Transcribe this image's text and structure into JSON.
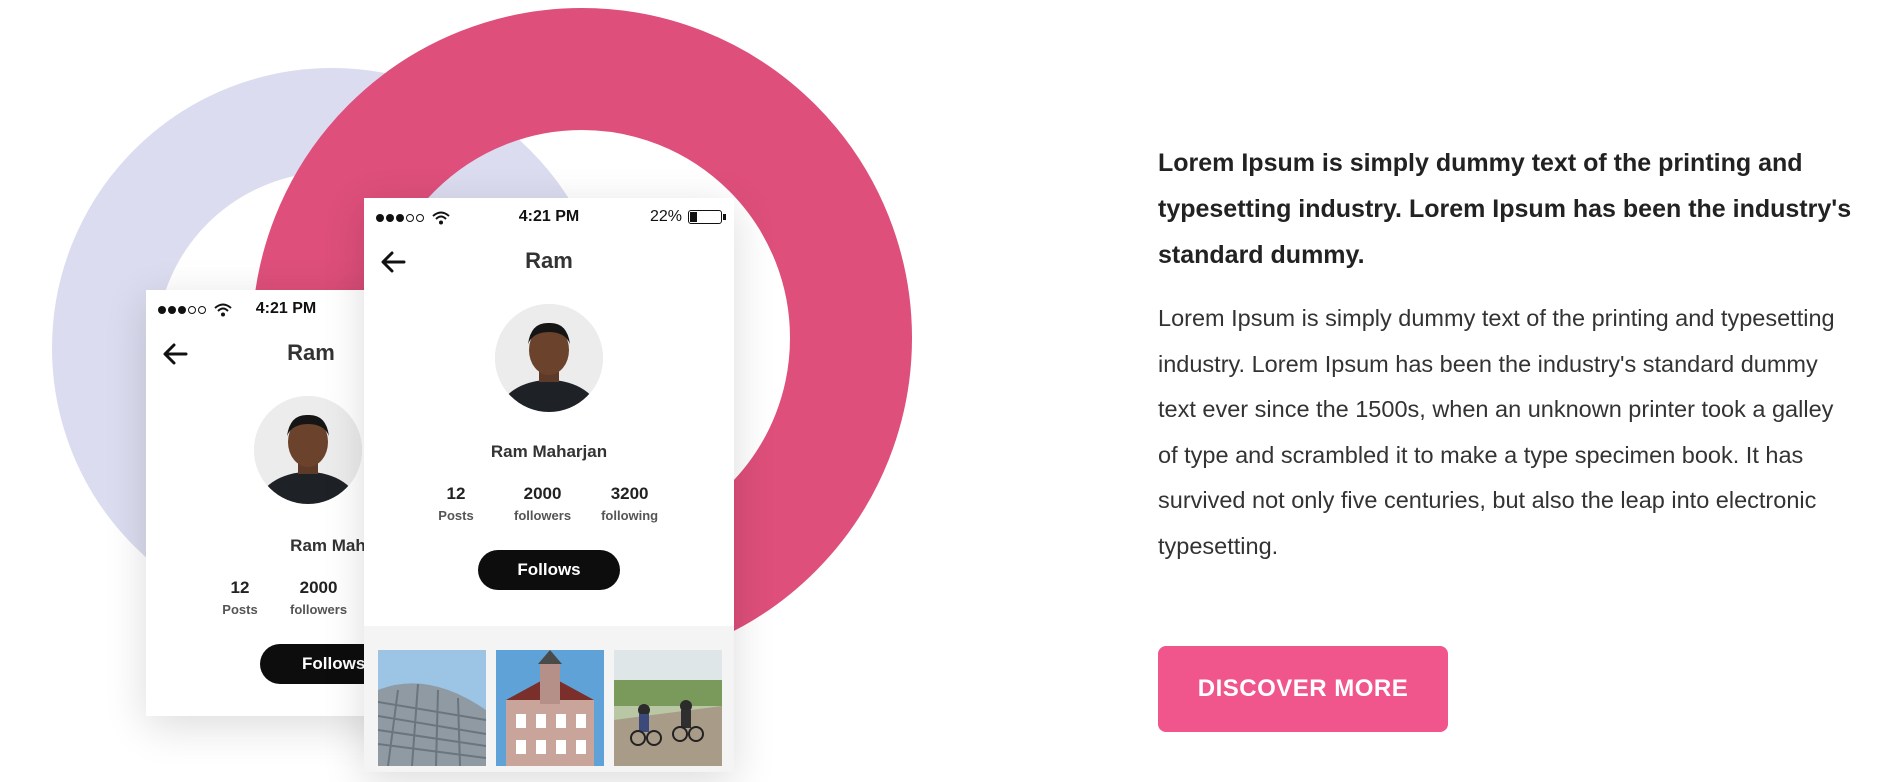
{
  "colors": {
    "ring_lavender": "#dcdcf0",
    "ring_pink": "#de4f7b",
    "button_pink": "#f0568b",
    "follow_button": "#0d0d0d"
  },
  "phone_front": {
    "time": "4:21 PM",
    "battery_text": "22%",
    "battery_level": 0.22,
    "title": "Ram",
    "full_name": "Ram Maharjan",
    "stats": [
      {
        "value": "12",
        "label": "Posts"
      },
      {
        "value": "2000",
        "label": "followers"
      },
      {
        "value": "3200",
        "label": "following"
      }
    ],
    "follow_label": "Follows"
  },
  "phone_back": {
    "time": "4:21 PM",
    "title": "Ram",
    "full_name": "Ram Mahar",
    "stats": [
      {
        "value": "12",
        "label": "Posts"
      },
      {
        "value": "2000",
        "label": "followers"
      }
    ],
    "follow_label": "Follows"
  },
  "content": {
    "lead": "Lorem Ipsum is simply dummy text of the printing and typesetting industry. Lorem Ipsum has been the industry's standard dummy.",
    "body": "Lorem Ipsum is simply dummy text of the printing and typesetting industry. Lorem Ipsum has been the industry's standard dummy text ever since the 1500s, when an unknown printer took a galley of type and scrambled it to make a type specimen book. It has survived not only five centuries, but also the leap into electronic typesetting.",
    "cta_label": "DISCOVER MORE"
  }
}
